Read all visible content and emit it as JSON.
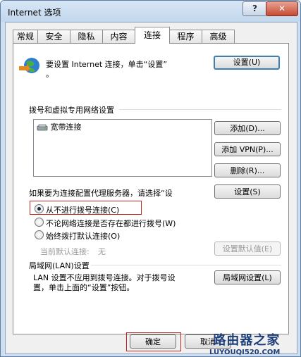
{
  "window": {
    "title": "Internet 选项",
    "help_label": "?",
    "close_label": "✕"
  },
  "tabs": [
    {
      "label": "常规",
      "active": false
    },
    {
      "label": "安全",
      "active": false
    },
    {
      "label": "隐私",
      "active": false
    },
    {
      "label": "内容",
      "active": false
    },
    {
      "label": "连接",
      "active": true
    },
    {
      "label": "程序",
      "active": false
    },
    {
      "label": "高级",
      "active": false
    }
  ],
  "setup": {
    "icon": "globe-network-icon",
    "text_line1": "要设置 Internet 连接，单击“设置”",
    "text_line2": "。",
    "button_label": "设置(U)"
  },
  "dialup": {
    "section_title": "拨号和虚拟专用网络设置",
    "list_items": [
      {
        "label": "宽带连接",
        "icon": "broadband-connection-icon"
      }
    ],
    "add_label": "添加(D)...",
    "add_vpn_label": "添加 VPN(P)...",
    "delete_label": "删除(R)...",
    "proxy_text": "如果要为连接配置代理服务器，请选择“设",
    "settings_label": "设置(S)",
    "radio_options": [
      {
        "label": "从不进行拨号连接(C)",
        "checked": true
      },
      {
        "label": "不论网络连接是否存在都进行拨号(W)",
        "checked": false
      },
      {
        "label": "始终拨打默认连接(O)",
        "checked": false
      }
    ],
    "current_default_label": "当前默认连接:",
    "current_default_value": "无",
    "set_default_label": "设置默认值(E)"
  },
  "lan": {
    "section_title": "局域网(LAN)设置",
    "text_line1": "LAN 设置不应用到拨号连接。对于拨号设",
    "text_line2": "置，单击上面的“设置”按钮。",
    "button_label": "局域网设置(L)"
  },
  "footer": {
    "ok_label": "确定",
    "cancel_label": "取消"
  },
  "watermark": {
    "title": "路由器之家",
    "url": "LUYOUQI520.COM"
  }
}
